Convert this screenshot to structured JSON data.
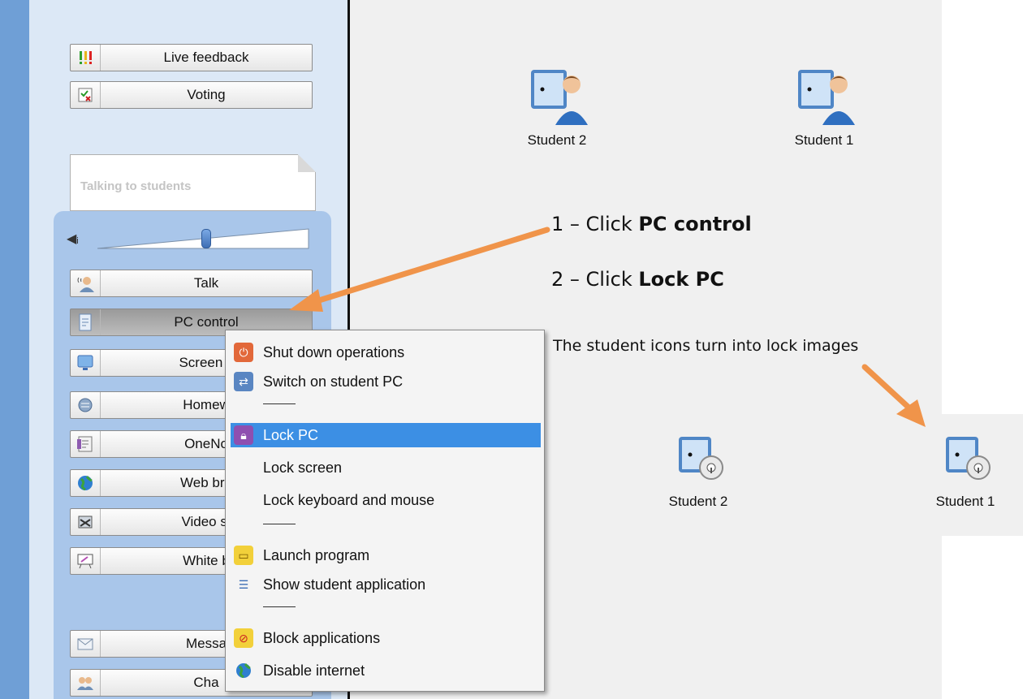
{
  "sidebar": {
    "buttons_top": [
      {
        "label": "Live feedback",
        "icon": "live-feedback-icon"
      },
      {
        "label": "Voting",
        "icon": "voting-icon"
      }
    ],
    "note_card": "Talking to students",
    "buttons_talk": [
      {
        "label": "Talk",
        "icon": "talk-icon"
      },
      {
        "label": "PC control",
        "icon": "pc-control-icon"
      },
      {
        "label": "Screen c",
        "icon": "screen-icon"
      },
      {
        "label": "Homew",
        "icon": "homework-icon"
      },
      {
        "label": "OneNo",
        "icon": "onenote-icon"
      },
      {
        "label": "Web bro",
        "icon": "globe-icon"
      },
      {
        "label": "Video st",
        "icon": "video-icon"
      },
      {
        "label": "White b",
        "icon": "whiteboard-icon"
      },
      {
        "label": "Messa",
        "icon": "envelope-icon"
      },
      {
        "label": "Cha",
        "icon": "chat-icon"
      }
    ]
  },
  "students_top": [
    {
      "label": "Student 2"
    },
    {
      "label": "Student 1"
    }
  ],
  "students_locked": [
    {
      "label": "Student 2"
    },
    {
      "label": "Student 1"
    }
  ],
  "menu": {
    "items": [
      {
        "label": "Shut down operations",
        "icon": "power-icon"
      },
      {
        "label": "Switch on student PC",
        "icon": "switch-icon"
      },
      {
        "label": "Lock PC",
        "icon": "lock-icon",
        "selected": true
      },
      {
        "label": "Lock screen",
        "icon": ""
      },
      {
        "label": "Lock keyboard and mouse",
        "icon": ""
      },
      {
        "label": "Launch program",
        "icon": "launch-icon"
      },
      {
        "label": "Show student application",
        "icon": "application-icon"
      },
      {
        "label": "Block applications",
        "icon": "block-icon"
      },
      {
        "label": "Disable internet",
        "icon": "globe-icon"
      }
    ]
  },
  "annotations": {
    "step1_prefix": "1 – Click ",
    "step1_bold": "PC control",
    "step2_prefix": "2 – Click ",
    "step2_bold": "Lock PC",
    "caption": "The student icons turn into lock images"
  },
  "colors": {
    "arrow": "#f0944a",
    "menu_selection": "#3c8fe4",
    "sidebar": "#dce8f6",
    "panel": "#a9c6ea"
  }
}
